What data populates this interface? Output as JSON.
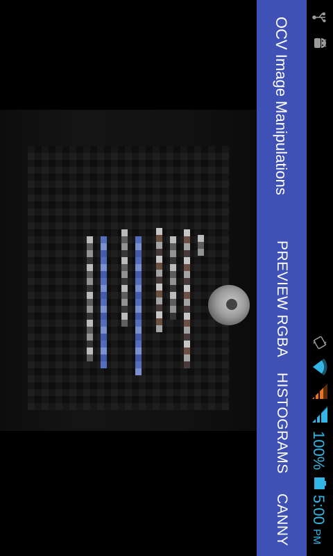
{
  "app": {
    "title": "OCV Image Manipulations"
  },
  "actionbar": {
    "items": [
      {
        "label": "PREVIEW RGBA"
      },
      {
        "label": "HISTOGRAMS"
      },
      {
        "label": "CANNY"
      }
    ]
  },
  "statusbar": {
    "battery": "100%",
    "time": "5:00",
    "ampm": "PM",
    "icons": [
      "usb-icon",
      "android-debug-icon",
      "vibrate-icon",
      "wifi-icon",
      "signal-icon",
      "signal-icon",
      "battery-icon"
    ]
  },
  "colors": {
    "actionbar_bg": "#3f51b5",
    "status_accent": "#33b5e5",
    "signal_orange": "#e8731a",
    "background": "#000000"
  }
}
